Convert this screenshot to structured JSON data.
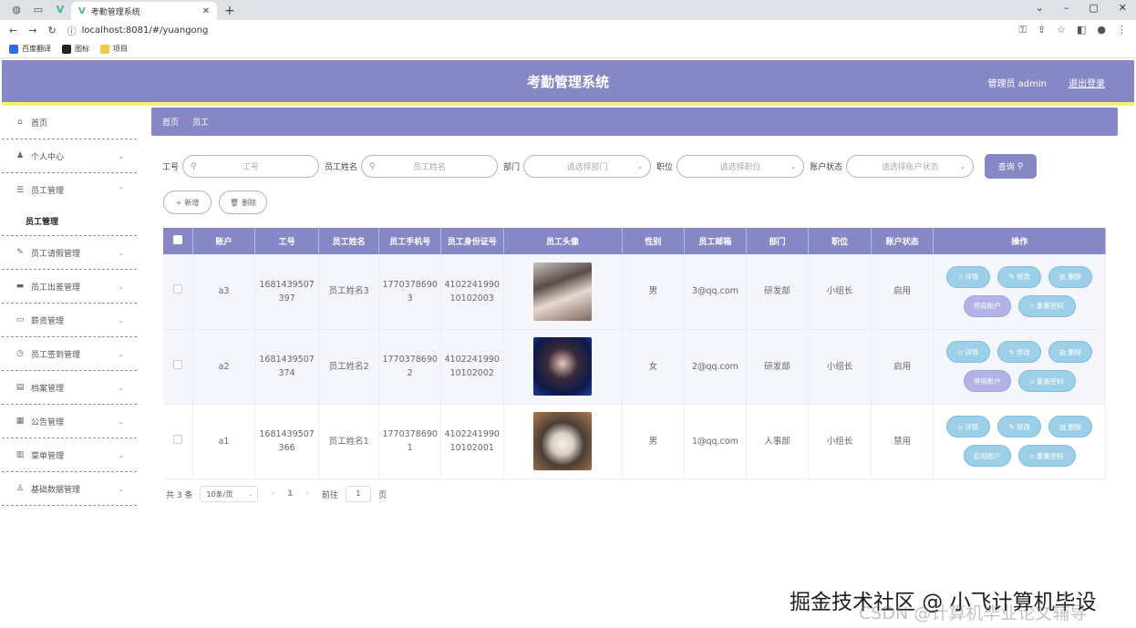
{
  "browser": {
    "tab_title": "考勤管理系统",
    "url": "localhost:8081/#/yuangong",
    "bookmarks": [
      {
        "label": "百度翻译",
        "color": "#2d6fe0"
      },
      {
        "label": "图标",
        "color": "#222222"
      },
      {
        "label": "项目",
        "color": "#f2c94c"
      }
    ]
  },
  "header": {
    "title": "考勤管理系统",
    "user": "管理员 admin",
    "logout": "退出登录"
  },
  "sidebar": {
    "items": [
      {
        "label": "首页",
        "icon": "home-icon"
      },
      {
        "label": "个人中心",
        "icon": "user-icon"
      },
      {
        "label": "员工管理",
        "icon": "menu-icon",
        "expanded": true,
        "sub": "员工管理"
      },
      {
        "label": "员工请假管理",
        "icon": "leave-icon"
      },
      {
        "label": "员工出差管理",
        "icon": "monitor-icon"
      },
      {
        "label": "薪资管理",
        "icon": "chat-icon"
      },
      {
        "label": "员工签到管理",
        "icon": "clock-icon"
      },
      {
        "label": "档案管理",
        "icon": "folder-icon"
      },
      {
        "label": "公告管理",
        "icon": "notice-icon"
      },
      {
        "label": "菜单管理",
        "icon": "doc-icon"
      },
      {
        "label": "基础数据管理",
        "icon": "person-icon"
      }
    ]
  },
  "breadcrumb": {
    "home": "首页",
    "sep": "/",
    "current": "员工"
  },
  "search": {
    "id_label": "工号",
    "id_placeholder": "工号",
    "name_label": "员工姓名",
    "name_placeholder": "员工姓名",
    "dept_label": "部门",
    "dept_placeholder": "请选择部门",
    "pos_label": "职位",
    "pos_placeholder": "请选择职位",
    "status_label": "账户状态",
    "status_placeholder": "请选择账户状态",
    "query_label": "查询"
  },
  "actions": {
    "add": "新增",
    "delete": "删除"
  },
  "table": {
    "headers": [
      "账户",
      "工号",
      "员工姓名",
      "员工手机号",
      "员工身份证号",
      "员工头像",
      "性别",
      "员工邮箱",
      "部门",
      "职位",
      "账户状态",
      "操作"
    ],
    "rows": [
      {
        "account": "a3",
        "id_line1": "1681439507",
        "id_line2": "397",
        "name": "员工姓名3",
        "phone_line1": "1770378690",
        "phone_line2": "3",
        "idcard_line1": "4102241990",
        "idcard_line2": "10102003",
        "gender": "男",
        "email": "3@qq.com",
        "dept": "研发部",
        "position": "小组长",
        "status": "启用",
        "toggle": "停用账户"
      },
      {
        "account": "a2",
        "id_line1": "1681439507",
        "id_line2": "374",
        "name": "员工姓名2",
        "phone_line1": "1770378690",
        "phone_line2": "2",
        "idcard_line1": "4102241990",
        "idcard_line2": "10102002",
        "gender": "女",
        "email": "2@qq.com",
        "dept": "研发部",
        "position": "小组长",
        "status": "启用",
        "toggle": "停用账户"
      },
      {
        "account": "a1",
        "id_line1": "1681439507",
        "id_line2": "366",
        "name": "员工姓名1",
        "phone_line1": "1770378690",
        "phone_line2": "1",
        "idcard_line1": "4102241990",
        "idcard_line2": "10102001",
        "gender": "男",
        "email": "1@qq.com",
        "dept": "人事部",
        "position": "小组长",
        "status": "禁用",
        "toggle": "启用账户"
      }
    ],
    "op_labels": {
      "detail": "详情",
      "edit": "修改",
      "delete": "删除",
      "reset": "重置密码"
    }
  },
  "pagination": {
    "total": "共 3 条",
    "page_size": "10条/页",
    "current": "1",
    "goto_label": "前往",
    "goto_value": "1",
    "page_unit": "页"
  },
  "watermark": {
    "line1": "掘金技术社区 @ 小飞计算机毕设",
    "line2": "CSDN @计算机毕业论文辅导"
  }
}
